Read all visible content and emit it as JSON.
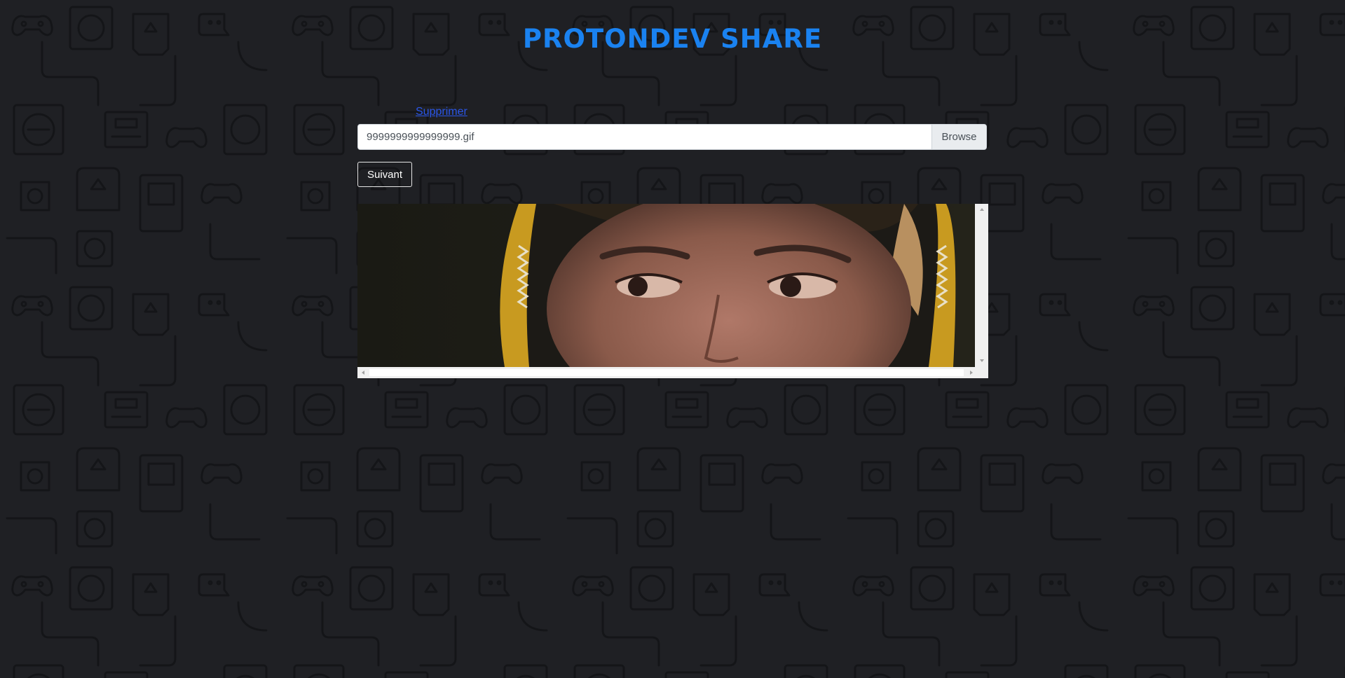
{
  "header": {
    "title": "PROTONDEV SHARE"
  },
  "upload": {
    "delete_label": "Supprimer",
    "file_name": "9999999999999999.gif",
    "browse_label": "Browse",
    "next_label": "Suivant"
  },
  "colors": {
    "background": "#1f2024",
    "pattern_stroke": "#141518",
    "title": "#1a82f0",
    "link": "#2a56e8"
  },
  "icons": {
    "background_pattern": "game-console-pattern",
    "preview": "gif-preview-image"
  }
}
